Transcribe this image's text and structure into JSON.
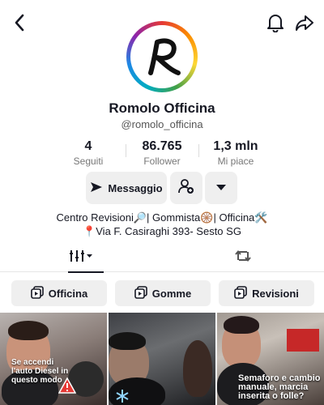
{
  "profile": {
    "display_name": "Romolo Officina",
    "username": "@romolo_officina",
    "avatar_letter": "R"
  },
  "stats": {
    "following_value": "4",
    "following_label": "Seguiti",
    "followers_value": "86.765",
    "followers_label": "Follower",
    "likes_value": "1,3 mln",
    "likes_label": "Mi piace"
  },
  "actions": {
    "message_label": "Messaggio"
  },
  "bio": {
    "line1": "Centro Revisioni🔎| Gommista🛞| Officina🛠️",
    "line2": "📍Via F. Casiraghi 393- Sesto SG"
  },
  "playlists": [
    "Officina",
    "Gomme",
    "Revisioni"
  ],
  "videos": [
    {
      "caption": "Se accendi l'auto Diesel in questo modo"
    },
    {
      "caption": ""
    },
    {
      "caption": "Semaforo e cambio manuale, marcia inserita o folle?"
    }
  ],
  "icons": {
    "back": "chevron-left-icon",
    "notifications": "bell-icon",
    "share": "share-arrow-icon",
    "send": "send-icon",
    "add_friend": "add-friend-icon",
    "more": "caret-down-icon",
    "videos_tab": "grid-filter-icon",
    "reposts_tab": "repost-icon",
    "playlist": "playlist-icon"
  }
}
